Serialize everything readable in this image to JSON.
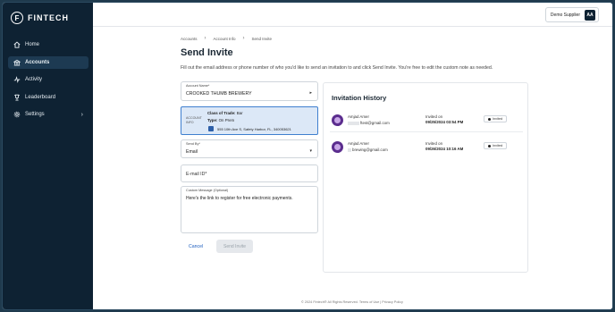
{
  "app": {
    "logo_letter": "F",
    "name": "FINTECH"
  },
  "sidebar": {
    "items": [
      {
        "label": "Home",
        "icon": "home-icon"
      },
      {
        "label": "Accounts",
        "icon": "bank-icon"
      },
      {
        "label": "Activity",
        "icon": "activity-icon"
      },
      {
        "label": "Leaderboard",
        "icon": "trophy-icon"
      },
      {
        "label": "Settings",
        "icon": "gear-icon"
      }
    ],
    "settings_chevron": "›"
  },
  "topbar": {
    "supplier_label": "Demo Supplier",
    "avatar_initials": "AA"
  },
  "breadcrumb": {
    "items": [
      "Accounts",
      "Account Info",
      "Send Invite"
    ],
    "separator": "›"
  },
  "page": {
    "title": "Send Invite",
    "description": "Fill out the email address or phone number of who you'd like to send an invitation to and click Send Invite. You're free to edit the custom note as needed."
  },
  "form": {
    "account_name_label": "Account Name*",
    "account_name_value": "CROOKED THUMB BREWERY",
    "account_info": {
      "label_line1": "ACCOUNT",
      "label_line2": "INFO",
      "class_of_trade_label": "Class of Trade:",
      "class_of_trade_value": "Bar",
      "type_label": "Type:",
      "type_value": "On Prem",
      "address": "555 10th Ave S, Safety Harbor, FL, 340053621"
    },
    "send_by_label": "Send By*",
    "send_by_value": "Email",
    "email_placeholder": "E-mail ID*",
    "custom_message_label": "Custom Message (Optional)",
    "custom_message_value": "Here's the link to register for free electronic payments.",
    "cancel_label": "Cancel",
    "send_label": "Send Invite"
  },
  "history": {
    "title": "Invitation History",
    "entries": [
      {
        "name": "Amjad Amer",
        "email_suffix": "ftest@gmail.com",
        "invited_label": "Invited on",
        "invited_at": "09/25/2024 03:54 PM",
        "status": "Invited"
      },
      {
        "name": "Amjad Amer",
        "email_suffix": "brewing@gmail.com",
        "invited_label": "Invited on",
        "invited_at": "09/26/2024 10:16 AM",
        "status": "Invited"
      }
    ]
  },
  "footer": {
    "text": "© 2024 Fintech® All Rights Reserved. Terms of Use | Privacy Policy"
  },
  "colors": {
    "sidebar_bg": "#0e2233",
    "accent": "#1f5fbf",
    "info_card_bg": "#dce8f7",
    "avatar_purple": "#5b2d8e"
  }
}
